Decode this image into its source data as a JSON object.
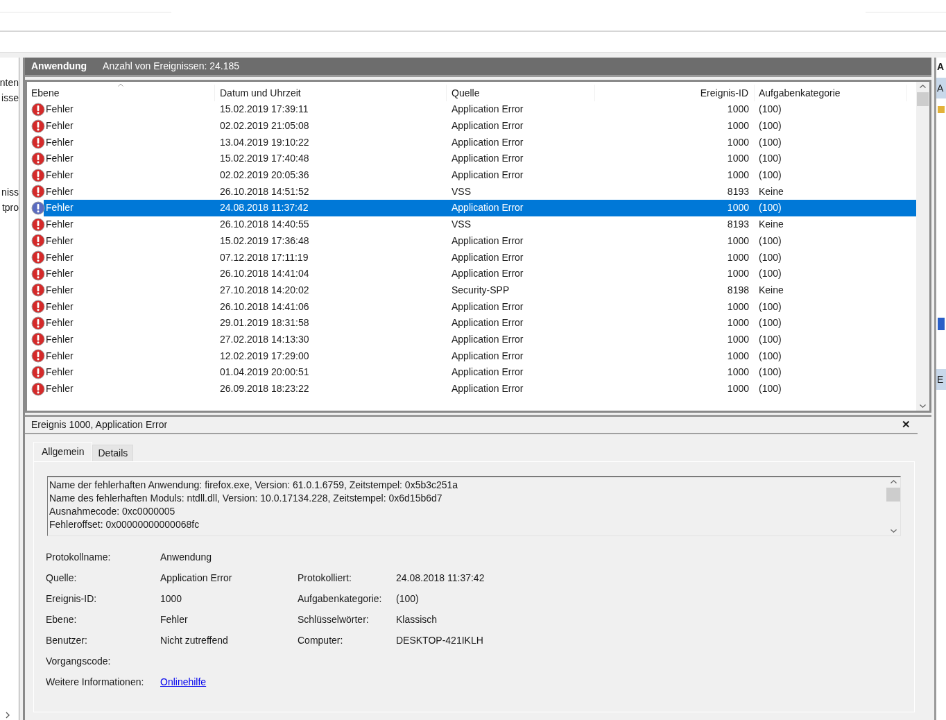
{
  "left_pane": {
    "groups": [
      [
        "nten",
        "isse"
      ],
      [
        "niss",
        "tpro"
      ]
    ]
  },
  "log_header": {
    "title": "Anwendung",
    "count": "Anzahl von Ereignissen: 24.185"
  },
  "table": {
    "columns": [
      "Ebene",
      "Datum und Uhrzeit",
      "Quelle",
      "Ereignis-ID",
      "Aufgabenkategorie"
    ],
    "rows": [
      {
        "level": "Fehler",
        "kind": "error",
        "date": "15.02.2019 17:39:11",
        "source": "Application Error",
        "id": "1000",
        "category": "(100)",
        "selected": false
      },
      {
        "level": "Fehler",
        "kind": "error",
        "date": "02.02.2019 21:05:08",
        "source": "Application Error",
        "id": "1000",
        "category": "(100)",
        "selected": false
      },
      {
        "level": "Fehler",
        "kind": "error",
        "date": "13.04.2019 19:10:22",
        "source": "Application Error",
        "id": "1000",
        "category": "(100)",
        "selected": false
      },
      {
        "level": "Fehler",
        "kind": "error",
        "date": "15.02.2019 17:40:48",
        "source": "Application Error",
        "id": "1000",
        "category": "(100)",
        "selected": false
      },
      {
        "level": "Fehler",
        "kind": "error",
        "date": "02.02.2019 20:05:36",
        "source": "Application Error",
        "id": "1000",
        "category": "(100)",
        "selected": false
      },
      {
        "level": "Fehler",
        "kind": "error",
        "date": "26.10.2018 14:51:52",
        "source": "VSS",
        "id": "8193",
        "category": "Keine",
        "selected": false
      },
      {
        "level": "Fehler",
        "kind": "error",
        "date": "24.08.2018 11:37:42",
        "source": "Application Error",
        "id": "1000",
        "category": "(100)",
        "selected": true
      },
      {
        "level": "Fehler",
        "kind": "error",
        "date": "26.10.2018 14:40:55",
        "source": "VSS",
        "id": "8193",
        "category": "Keine",
        "selected": false
      },
      {
        "level": "Fehler",
        "kind": "error",
        "date": "15.02.2019 17:36:48",
        "source": "Application Error",
        "id": "1000",
        "category": "(100)",
        "selected": false
      },
      {
        "level": "Fehler",
        "kind": "error",
        "date": "07.12.2018 17:11:19",
        "source": "Application Error",
        "id": "1000",
        "category": "(100)",
        "selected": false
      },
      {
        "level": "Fehler",
        "kind": "error",
        "date": "26.10.2018 14:41:04",
        "source": "Application Error",
        "id": "1000",
        "category": "(100)",
        "selected": false
      },
      {
        "level": "Fehler",
        "kind": "error",
        "date": "27.10.2018 14:20:02",
        "source": "Security-SPP",
        "id": "8198",
        "category": "Keine",
        "selected": false
      },
      {
        "level": "Fehler",
        "kind": "error",
        "date": "26.10.2018 14:41:06",
        "source": "Application Error",
        "id": "1000",
        "category": "(100)",
        "selected": false
      },
      {
        "level": "Fehler",
        "kind": "error",
        "date": "29.01.2019 18:31:58",
        "source": "Application Error",
        "id": "1000",
        "category": "(100)",
        "selected": false
      },
      {
        "level": "Fehler",
        "kind": "error",
        "date": "27.02.2018 14:13:30",
        "source": "Application Error",
        "id": "1000",
        "category": "(100)",
        "selected": false
      },
      {
        "level": "Fehler",
        "kind": "error",
        "date": "12.02.2019 17:29:00",
        "source": "Application Error",
        "id": "1000",
        "category": "(100)",
        "selected": false
      },
      {
        "level": "Fehler",
        "kind": "error",
        "date": "01.04.2019 20:00:51",
        "source": "Application Error",
        "id": "1000",
        "category": "(100)",
        "selected": false
      },
      {
        "level": "Fehler",
        "kind": "error",
        "date": "26.09.2018 18:23:22",
        "source": "Application Error",
        "id": "1000",
        "category": "(100)",
        "selected": false
      }
    ]
  },
  "detail": {
    "title": "Ereignis 1000, Application Error",
    "close": "✕",
    "tabs": [
      {
        "label": "Allgemein",
        "selected": true
      },
      {
        "label": "Details",
        "selected": false
      }
    ],
    "message": [
      "Name der fehlerhaften Anwendung: firefox.exe, Version: 61.0.1.6759, Zeitstempel: 0x5b3c251a",
      "Name des fehlerhaften Moduls: ntdll.dll, Version: 10.0.17134.228, Zeitstempel: 0x6d15b6d7",
      "Ausnahmecode: 0xc0000005",
      "Fehleroffset: 0x00000000000068fc"
    ],
    "fields": [
      [
        {
          "label": "Protokollname:",
          "value": "Anwendung"
        }
      ],
      [
        {
          "label": "Quelle:",
          "value": "Application Error"
        },
        {
          "label": "Protokolliert:",
          "value": "24.08.2018 11:37:42"
        }
      ],
      [
        {
          "label": "Ereignis-ID:",
          "value": "1000"
        },
        {
          "label": "Aufgabenkategorie:",
          "value": "(100)"
        }
      ],
      [
        {
          "label": "Ebene:",
          "value": "Fehler"
        },
        {
          "label": "Schlüsselwörter:",
          "value": "Klassisch"
        }
      ],
      [
        {
          "label": "Benutzer:",
          "value": "Nicht zutreffend"
        },
        {
          "label": "Computer:",
          "value": "DESKTOP-421IKLH"
        }
      ],
      [
        {
          "label": "Vorgangscode:"
        }
      ],
      [
        {
          "label": "Weitere Informationen:",
          "value": "Onlinehilfe",
          "kind": "link"
        }
      ]
    ]
  },
  "actions_pane": {
    "items": [
      {
        "label": "A",
        "kind": "title"
      },
      {
        "label": "A",
        "kind": "section"
      },
      {
        "label": "E",
        "kind": "section"
      }
    ]
  }
}
